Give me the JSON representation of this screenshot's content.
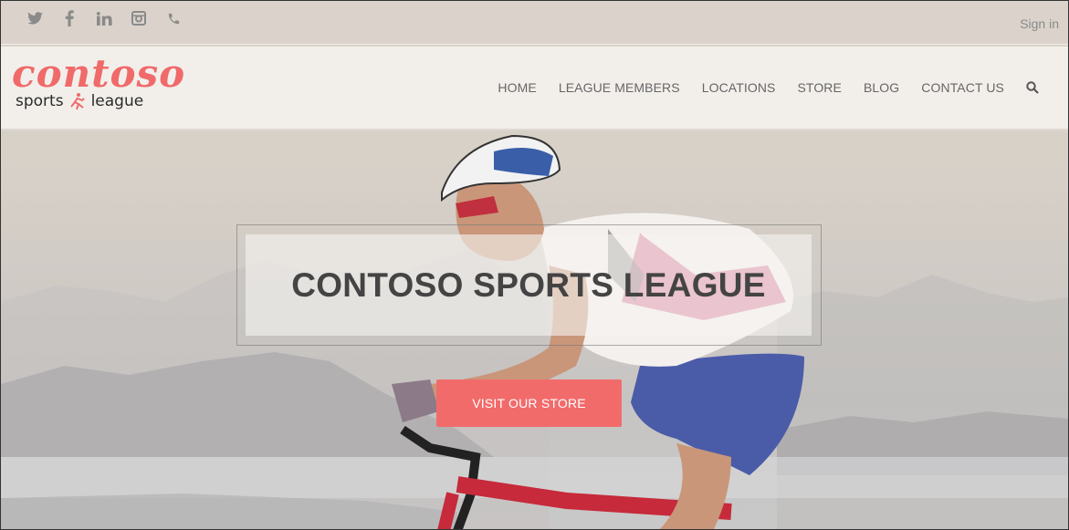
{
  "topbar": {
    "social_icons": [
      "twitter-icon",
      "facebook-icon",
      "linkedin-icon",
      "instagram-icon",
      "phone-icon"
    ],
    "signin_label": "Sign in"
  },
  "brand": {
    "logo_word": "contoso",
    "logo_sub_left": "sports",
    "logo_sub_right": "league",
    "accent": "#f06a6a"
  },
  "nav": {
    "items": [
      {
        "label": "HOME"
      },
      {
        "label": "LEAGUE MEMBERS"
      },
      {
        "label": "LOCATIONS"
      },
      {
        "label": "STORE"
      },
      {
        "label": "BLOG"
      },
      {
        "label": "CONTACT US"
      }
    ],
    "search_icon": "search-icon"
  },
  "hero": {
    "title": "CONTOSO SPORTS LEAGUE",
    "cta_label": "VISIT OUR STORE",
    "cta_color": "#f26b6b"
  }
}
